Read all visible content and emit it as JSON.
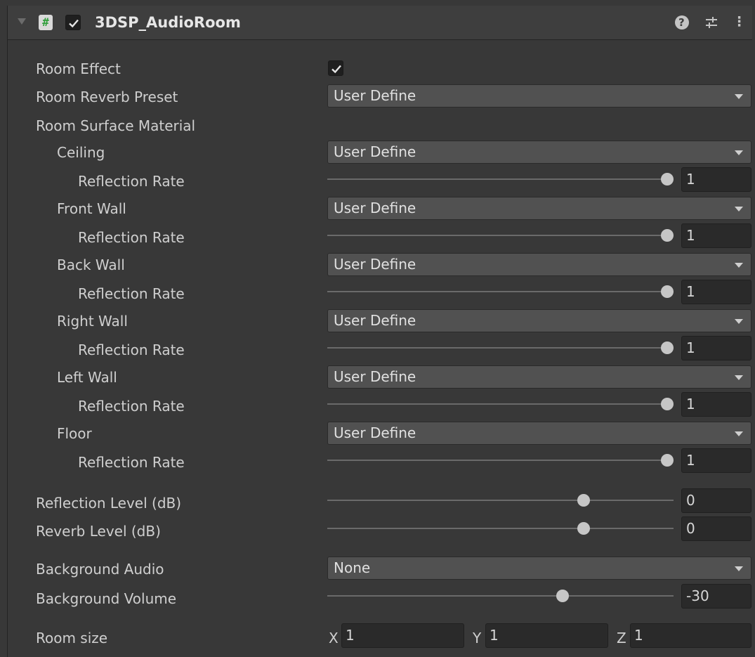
{
  "header": {
    "title": "3DSP_AudioRoom",
    "enabled": true,
    "icons": [
      "fold-arrow-icon",
      "script-icon",
      "help-icon",
      "preset-settings-icon",
      "more-menu-icon"
    ],
    "script_glyph": "#",
    "help_glyph": "?",
    "more_glyph": "⋮"
  },
  "room_effect": {
    "label": "Room Effect",
    "checked": true
  },
  "room_reverb_preset": {
    "label": "Room Reverb Preset",
    "value": "User Define"
  },
  "room_surface_material": {
    "label": "Room Surface Material"
  },
  "surfaces": [
    {
      "label": "Ceiling",
      "value": "User Define",
      "rate_label": "Reflection Rate",
      "rate": "1",
      "rate_fraction": 1.0
    },
    {
      "label": "Front Wall",
      "value": "User Define",
      "rate_label": "Reflection Rate",
      "rate": "1",
      "rate_fraction": 1.0
    },
    {
      "label": "Back Wall",
      "value": "User Define",
      "rate_label": "Reflection Rate",
      "rate": "1",
      "rate_fraction": 1.0
    },
    {
      "label": "Right Wall",
      "value": "User Define",
      "rate_label": "Reflection Rate",
      "rate": "1",
      "rate_fraction": 1.0
    },
    {
      "label": "Left Wall",
      "value": "User Define",
      "rate_label": "Reflection Rate",
      "rate": "1",
      "rate_fraction": 1.0
    },
    {
      "label": "Floor",
      "value": "User Define",
      "rate_label": "Reflection Rate",
      "rate": "1",
      "rate_fraction": 1.0
    }
  ],
  "reflection_level": {
    "label": "Reflection Level (dB)",
    "value": "0",
    "fraction": 0.74
  },
  "reverb_level": {
    "label": "Reverb Level (dB)",
    "value": "0",
    "fraction": 0.74
  },
  "background_audio": {
    "label": "Background Audio",
    "value": "None"
  },
  "background_volume": {
    "label": "Background Volume",
    "value": "-30",
    "fraction": 0.68
  },
  "room_size": {
    "label": "Room size",
    "x_label": "X",
    "x": "1",
    "y_label": "Y",
    "y": "1",
    "z_label": "Z",
    "z": "1"
  }
}
